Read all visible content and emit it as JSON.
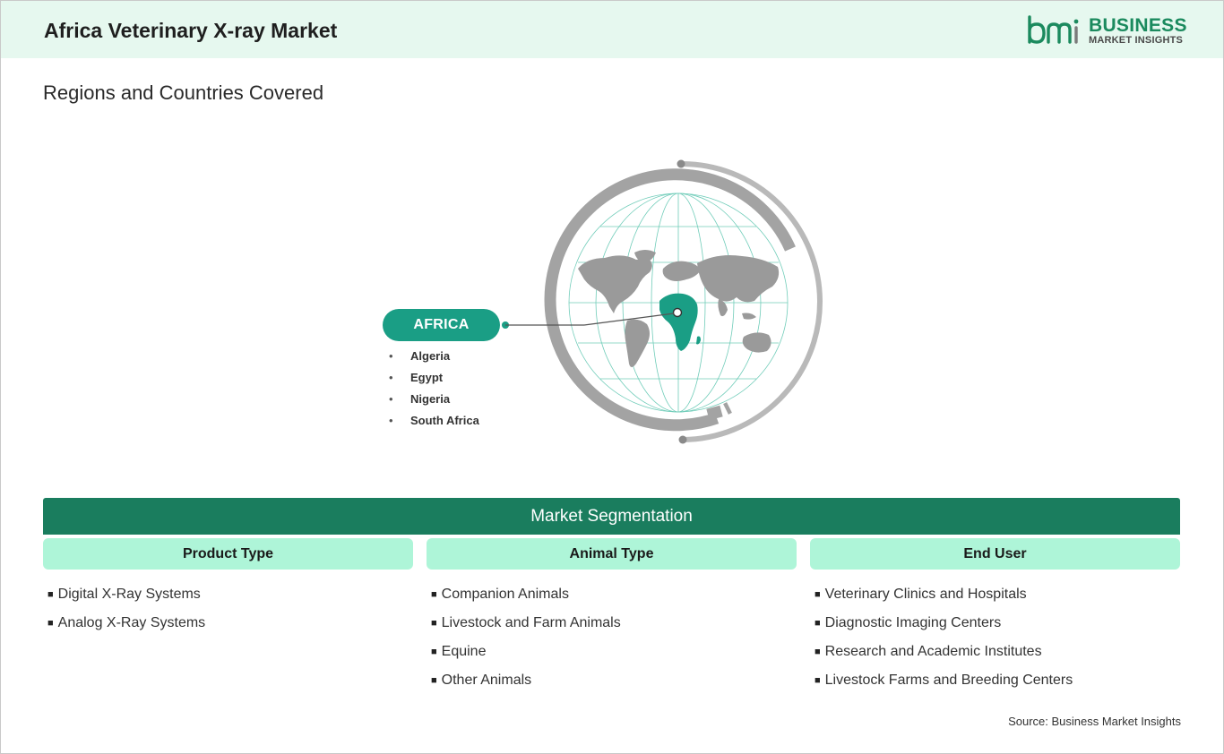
{
  "header": {
    "title": "Africa Veterinary X-ray Market",
    "logo_line1": "BUSINESS",
    "logo_line2": "MARKET INSIGHTS",
    "logo_mark": "bmi"
  },
  "regions_section": {
    "title": "Regions and Countries Covered",
    "region_label": "AFRICA",
    "countries": [
      "Algeria",
      "Egypt",
      "Nigeria",
      "South Africa"
    ],
    "bullet": "•"
  },
  "segmentation": {
    "title": "Market Segmentation",
    "bullet": "■",
    "columns": [
      {
        "heading": "Product Type",
        "items": [
          "Digital X-Ray Systems",
          "Analog X-Ray Systems"
        ]
      },
      {
        "heading": "Animal Type",
        "items": [
          "Companion Animals",
          "Livestock and Farm Animals",
          "Equine",
          "Other Animals"
        ]
      },
      {
        "heading": "End User",
        "items": [
          "Veterinary Clinics and Hospitals",
          "Diagnostic Imaging Centers",
          "Research and Academic Institutes",
          "Livestock Farms and Breeding Centers"
        ]
      }
    ]
  },
  "source": "Source: Business Market Insights",
  "colors": {
    "header_bg": "#e6f8ef",
    "brand_green": "#1b8a5e",
    "segment_bar": "#1a7d5e",
    "segment_head": "#aef5d8",
    "region_pill": "#1a9e85",
    "map_gray": "#9a9a9a",
    "ring_gray": "#a8a8a8"
  },
  "icons": {
    "globe": "world-globe-icon",
    "logo": "bmi-logo-icon"
  }
}
